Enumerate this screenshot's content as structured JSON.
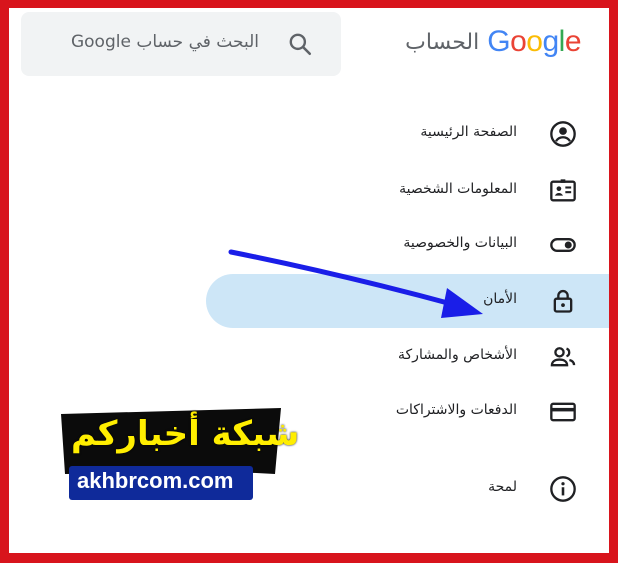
{
  "header": {
    "brand_google": [
      "G",
      "o",
      "o",
      "g",
      "l",
      "e"
    ],
    "brand_colors": [
      "#4285F4",
      "#EA4335",
      "#FBBC05",
      "#4285F4",
      "#34A853",
      "#EA4335"
    ],
    "brand_suffix": "الحساب",
    "search_placeholder": "البحث في حساب Google",
    "search_icon": "search-icon"
  },
  "nav": {
    "items": [
      {
        "label": "الصفحة الرئيسية",
        "icon": "account-circle-icon",
        "active": false
      },
      {
        "label": "المعلومات الشخصية",
        "icon": "id-card-icon",
        "active": false
      },
      {
        "label": "البيانات والخصوصية",
        "icon": "toggle-icon",
        "active": false
      },
      {
        "label": "الأمان",
        "icon": "lock-icon",
        "active": true
      },
      {
        "label": "الأشخاص والمشاركة",
        "icon": "people-icon",
        "active": false
      },
      {
        "label": "الدفعات والاشتراكات",
        "icon": "credit-card-icon",
        "active": false
      },
      {
        "label": "لمحة",
        "icon": "info-icon",
        "active": false
      }
    ]
  },
  "overlay": {
    "arrow_color": "#1a1ee8"
  },
  "watermark": {
    "arabic": "شبكة أخباركم",
    "latin": "akhbrcom.com"
  },
  "colors": {
    "frame": "#d8141c",
    "active_pill": "#cde6f7",
    "icon": "#202124"
  }
}
